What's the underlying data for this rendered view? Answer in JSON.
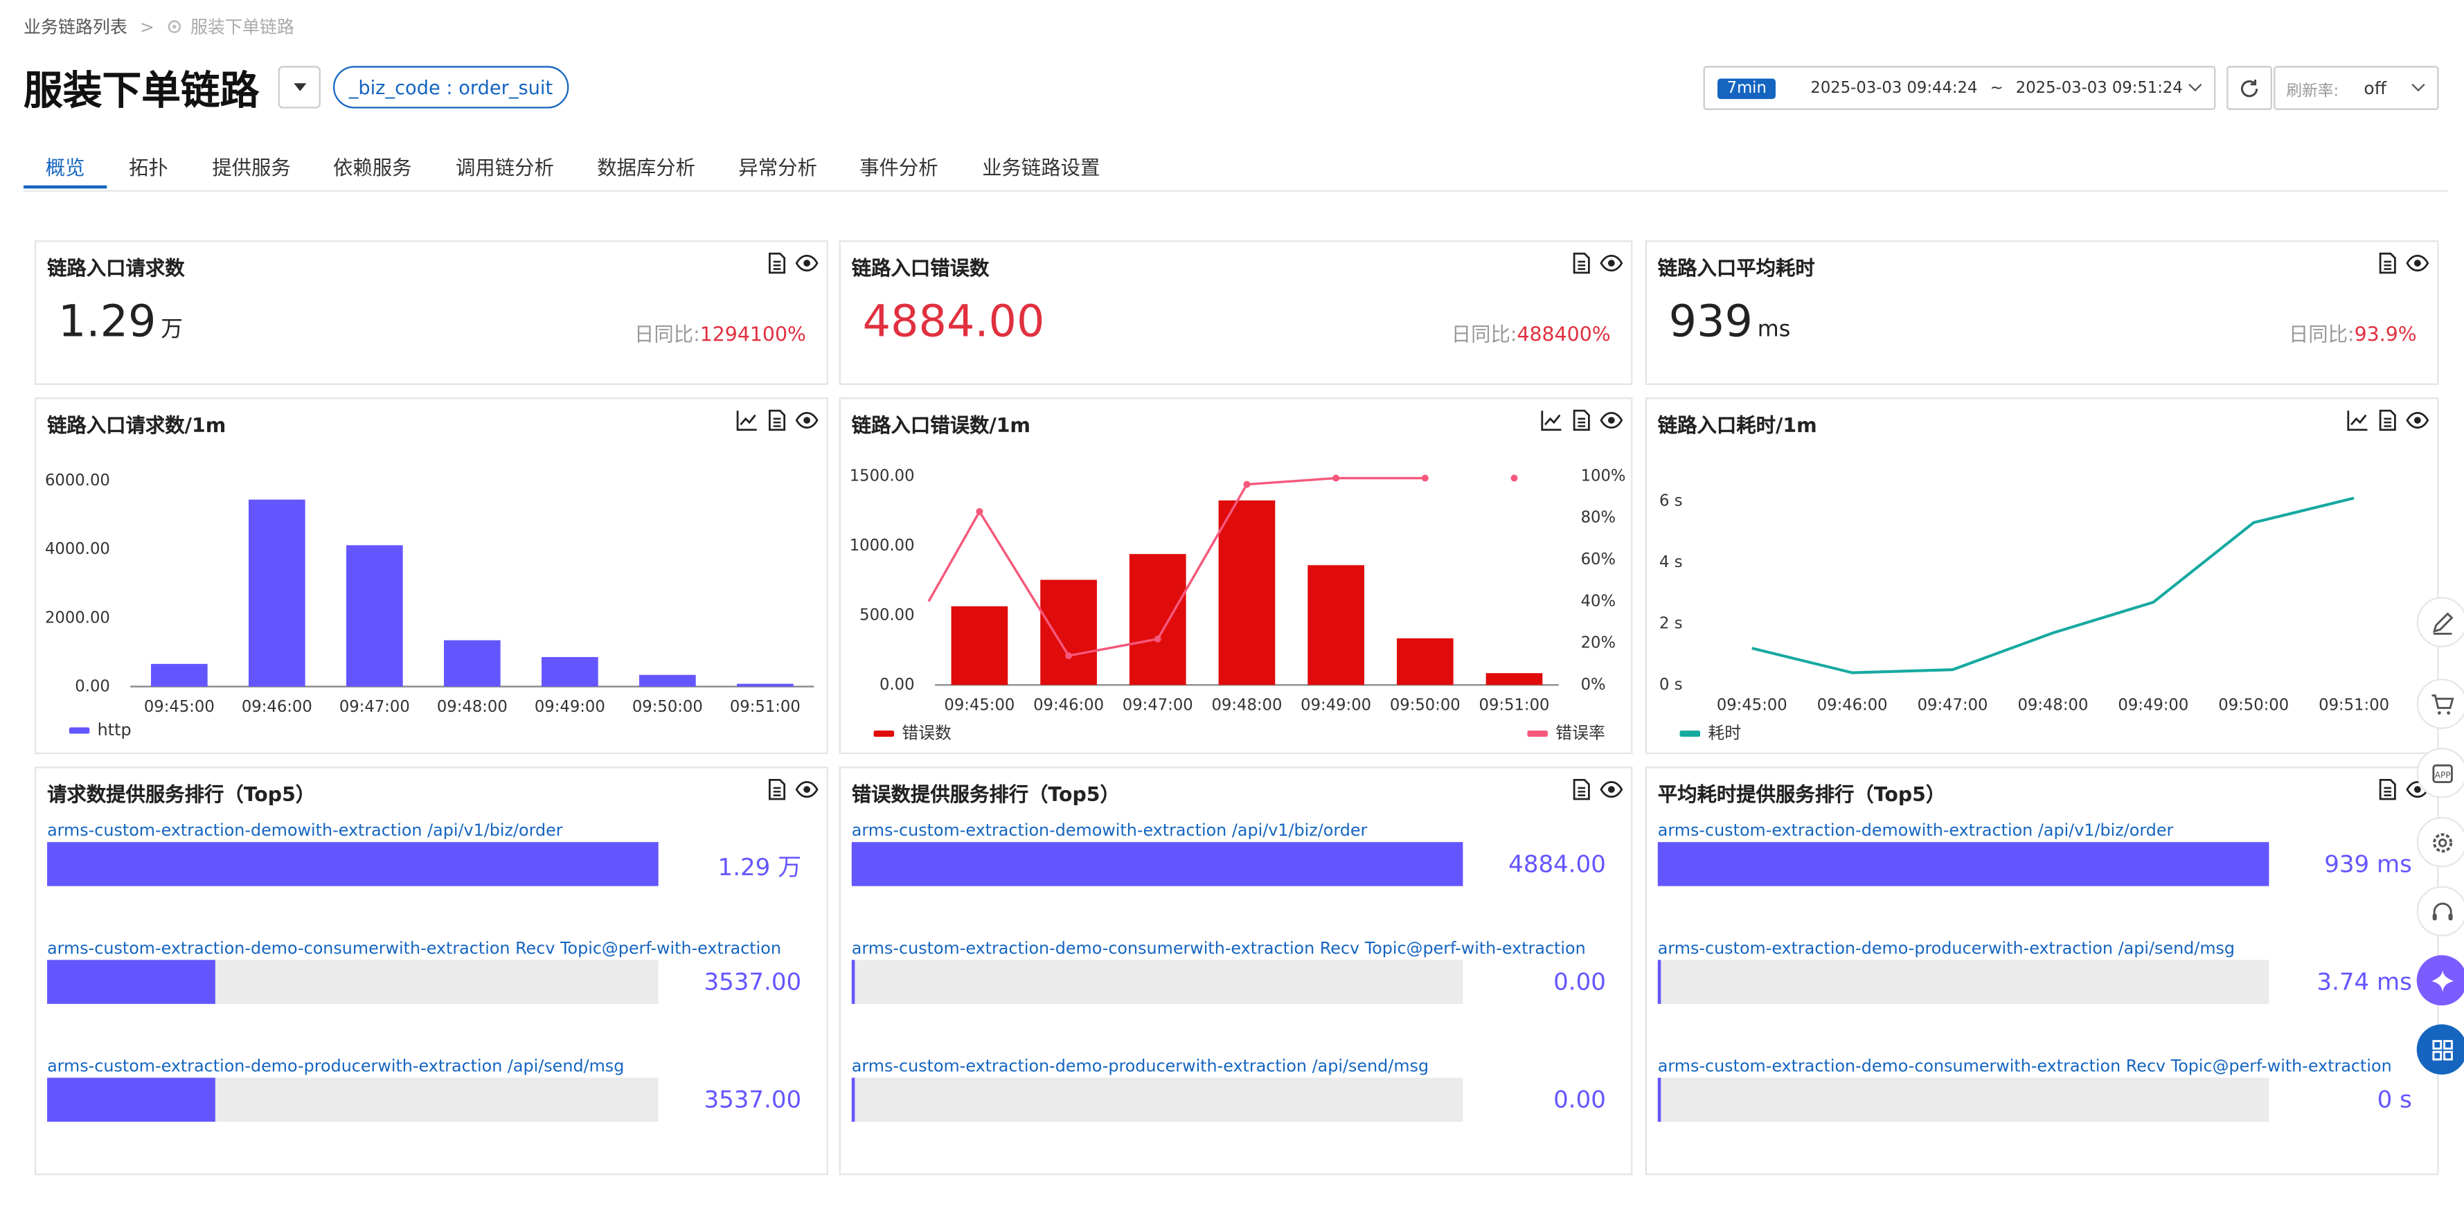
{
  "breadcrumb": {
    "parent": "业务链路列表",
    "current": "服装下单链路"
  },
  "header": {
    "title": "服装下单链路",
    "tag": "_biz_code : order_suit"
  },
  "time": {
    "badge": "7min",
    "start": "2025-03-03 09:44:24",
    "tilde": "~",
    "end": "2025-03-03 09:51:24"
  },
  "refresh": {
    "label": "刷新率:",
    "value": "off"
  },
  "tabs": [
    "概览",
    "拓扑",
    "提供服务",
    "依赖服务",
    "调用链分析",
    "数据库分析",
    "异常分析",
    "事件分析",
    "业务链路设置"
  ],
  "stats": [
    {
      "title": "链路入口请求数",
      "value": "1.29",
      "unit": "万",
      "ratio_label": "日同比:",
      "ratio_value": "1294100%"
    },
    {
      "title": "链路入口错误数",
      "value": "4884.00",
      "unit": "",
      "ratio_label": "日同比:",
      "ratio_value": "488400%"
    },
    {
      "title": "链路入口平均耗时",
      "value": "939",
      "unit": "ms",
      "ratio_label": "日同比:",
      "ratio_value": "93.9%"
    }
  ],
  "colors": {
    "accent": "#1565c0",
    "purple": "#6456ff",
    "red": "#e00b0b",
    "pink": "#f5587b",
    "teal": "#16a9a0",
    "negative": "#e0303f"
  },
  "chart_data": [
    {
      "type": "bar",
      "title": "链路入口请求数/1m",
      "categories": [
        "09:45:00",
        "09:46:00",
        "09:47:00",
        "09:48:00",
        "09:49:00",
        "09:50:00",
        "09:51:00"
      ],
      "series": [
        {
          "name": "http",
          "values": [
            660,
            5450,
            4120,
            1350,
            860,
            340,
            80
          ]
        }
      ],
      "yticks": [
        "6000.00",
        "4000.00",
        "2000.00",
        "0.00"
      ],
      "ylim": [
        0,
        6000
      ]
    },
    {
      "type": "bar",
      "title": "链路入口错误数/1m",
      "categories": [
        "09:45:00",
        "09:46:00",
        "09:47:00",
        "09:48:00",
        "09:49:00",
        "09:50:00",
        "09:51:00"
      ],
      "series": [
        {
          "name": "错误数",
          "values": [
            565,
            755,
            940,
            1325,
            860,
            335,
            85
          ]
        },
        {
          "name": "错误率",
          "type": "line",
          "values": [
            83,
            14,
            22,
            96,
            99,
            99,
            99
          ],
          "unit": "%"
        }
      ],
      "yticks": [
        "1500.00",
        "1000.00",
        "500.00",
        "0.00"
      ],
      "ylim": [
        0,
        1500
      ],
      "y2ticks": [
        "100%",
        "80%",
        "60%",
        "40%",
        "20%",
        "0%"
      ],
      "y2lim": [
        0,
        100
      ]
    },
    {
      "type": "line",
      "title": "链路入口耗时/1m",
      "categories": [
        "09:45:00",
        "09:46:00",
        "09:47:00",
        "09:48:00",
        "09:49:00",
        "09:50:00",
        "09:51:00"
      ],
      "series": [
        {
          "name": "耗时",
          "values": [
            1.2,
            0.4,
            0.5,
            1.7,
            2.7,
            5.3,
            6.1
          ]
        }
      ],
      "yticks": [
        "6 s",
        "4 s",
        "2 s",
        "0 s"
      ],
      "ylim": [
        0,
        7
      ]
    }
  ],
  "rankings": [
    {
      "title": "请求数提供服务排行（Top5）",
      "items": [
        {
          "label": "arms-custom-extraction-demowith-extraction /api/v1/biz/order",
          "value": "1.29 万",
          "fraction": 1.0
        },
        {
          "label": "arms-custom-extraction-demo-consumerwith-extraction Recv Topic@perf-with-extraction",
          "value": "3537.00",
          "fraction": 0.274
        },
        {
          "label": "arms-custom-extraction-demo-producerwith-extraction /api/send/msg",
          "value": "3537.00",
          "fraction": 0.274
        }
      ]
    },
    {
      "title": "错误数提供服务排行（Top5）",
      "items": [
        {
          "label": "arms-custom-extraction-demowith-extraction /api/v1/biz/order",
          "value": "4884.00",
          "fraction": 1.0
        },
        {
          "label": "arms-custom-extraction-demo-consumerwith-extraction Recv Topic@perf-with-extraction",
          "value": "0.00",
          "fraction": 0.005
        },
        {
          "label": "arms-custom-extraction-demo-producerwith-extraction /api/send/msg",
          "value": "0.00",
          "fraction": 0.005
        }
      ]
    },
    {
      "title": "平均耗时提供服务排行（Top5）",
      "items": [
        {
          "label": "arms-custom-extraction-demowith-extraction /api/v1/biz/order",
          "value": "939 ms",
          "fraction": 1.0
        },
        {
          "label": "arms-custom-extraction-demo-producerwith-extraction /api/send/msg",
          "value": "3.74 ms",
          "fraction": 0.005
        },
        {
          "label": "arms-custom-extraction-demo-consumerwith-extraction Recv Topic@perf-with-extraction",
          "value": "0 s",
          "fraction": 0.005
        }
      ]
    }
  ],
  "icons": [
    "document-icon",
    "eye-icon",
    "line-chart-icon",
    "edit-icon",
    "cart-icon",
    "app-icon",
    "gear-icon",
    "headset-icon",
    "ai-assistant-icon",
    "grid-icon",
    "refresh-icon",
    "chevron-right-icon"
  ]
}
